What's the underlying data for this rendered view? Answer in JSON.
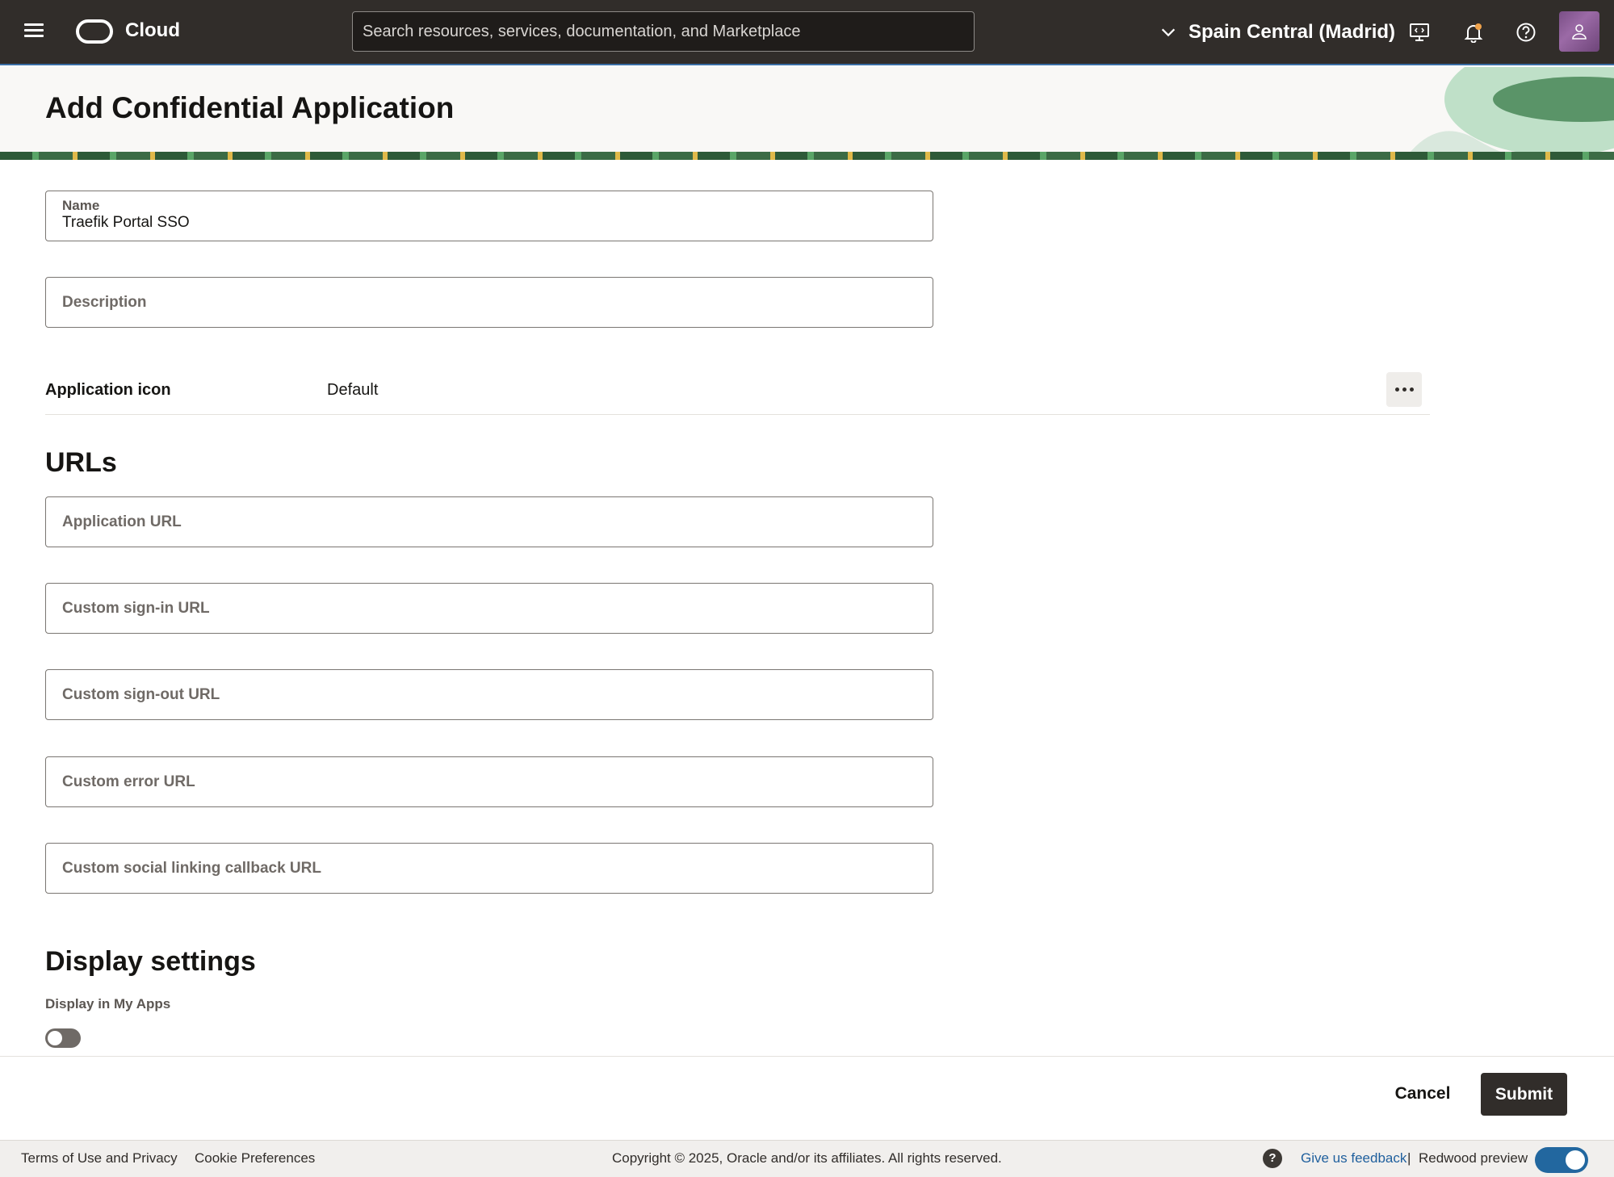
{
  "topbar": {
    "brand": "Cloud",
    "search_placeholder": "Search resources, services, documentation, and Marketplace",
    "region": "Spain Central (Madrid)"
  },
  "page": {
    "title": "Add Confidential Application"
  },
  "form": {
    "name_label": "Name",
    "name_value": "Traefik Portal SSO",
    "description_placeholder": "Description",
    "app_icon_label": "Application icon",
    "app_icon_value": "Default",
    "urls_heading": "URLs",
    "application_url_placeholder": "Application URL",
    "signin_url_placeholder": "Custom sign-in URL",
    "signout_url_placeholder": "Custom sign-out URL",
    "error_url_placeholder": "Custom error URL",
    "social_url_placeholder": "Custom social linking callback URL",
    "display_heading": "Display settings",
    "display_my_apps_label": "Display in My Apps"
  },
  "actions": {
    "cancel": "Cancel",
    "submit": "Submit"
  },
  "footer": {
    "terms": "Terms of Use and Privacy",
    "cookies": "Cookie Preferences",
    "copyright": "Copyright © 2025, Oracle and/or its affiliates. All rights reserved.",
    "help": "?",
    "feedback": "Give us feedback",
    "separator": "|",
    "redwood": "Redwood preview"
  }
}
